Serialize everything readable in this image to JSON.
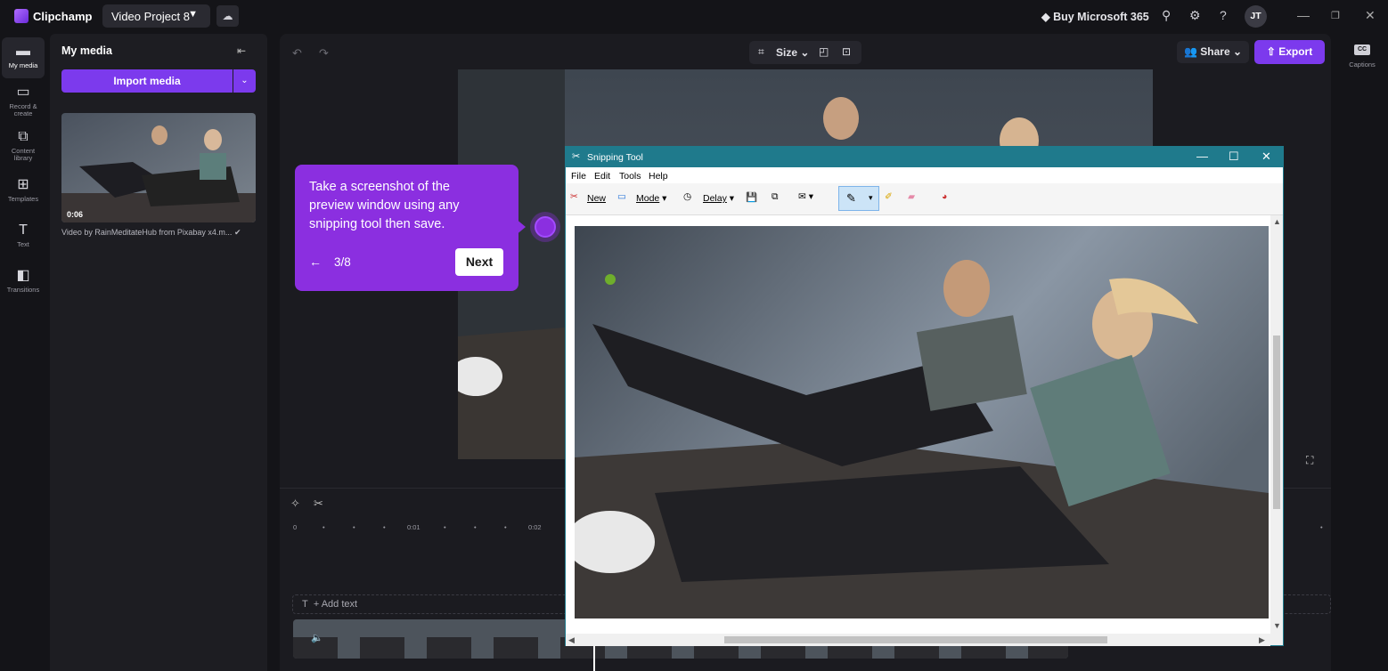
{
  "app": {
    "name": "Clipchamp",
    "project": "Video Project 8",
    "buy": "Buy Microsoft 365",
    "avatar": "JT"
  },
  "rail": [
    {
      "label": "My media",
      "icon": "folder-icon"
    },
    {
      "label": "Record &\ncreate",
      "icon": "camera-icon"
    },
    {
      "label": "Content\nlibrary",
      "icon": "library-icon"
    },
    {
      "label": "Templates",
      "icon": "templates-icon"
    },
    {
      "label": "Text",
      "icon": "text-icon"
    },
    {
      "label": "Transitions",
      "icon": "transitions-icon"
    }
  ],
  "media": {
    "title": "My media",
    "import_label": "Import media",
    "thumb_duration": "0:06",
    "thumb_caption": "Video by RainMeditateHub from Pixabay x4.m..."
  },
  "toolbar": {
    "size_label": "Size",
    "share_label": "Share",
    "export_label": "Export"
  },
  "captions": {
    "label": "Captions"
  },
  "timeline": {
    "ruler": [
      "0",
      "0:01",
      "0:02"
    ],
    "add_text": "+ Add text"
  },
  "tooltip": {
    "text": "Take a screenshot of the preview window using any snipping tool then save.",
    "step": "3/8",
    "next_label": "Next"
  },
  "snipping_tool": {
    "title": "Snipping Tool",
    "menu": [
      "File",
      "Edit",
      "Tools",
      "Help"
    ],
    "new_label": "New",
    "mode_label": "Mode",
    "delay_label": "Delay"
  },
  "colors": {
    "accent": "#7c3aed",
    "tooltip": "#8b2fe0",
    "snip_titlebar": "#1f7a8c"
  }
}
